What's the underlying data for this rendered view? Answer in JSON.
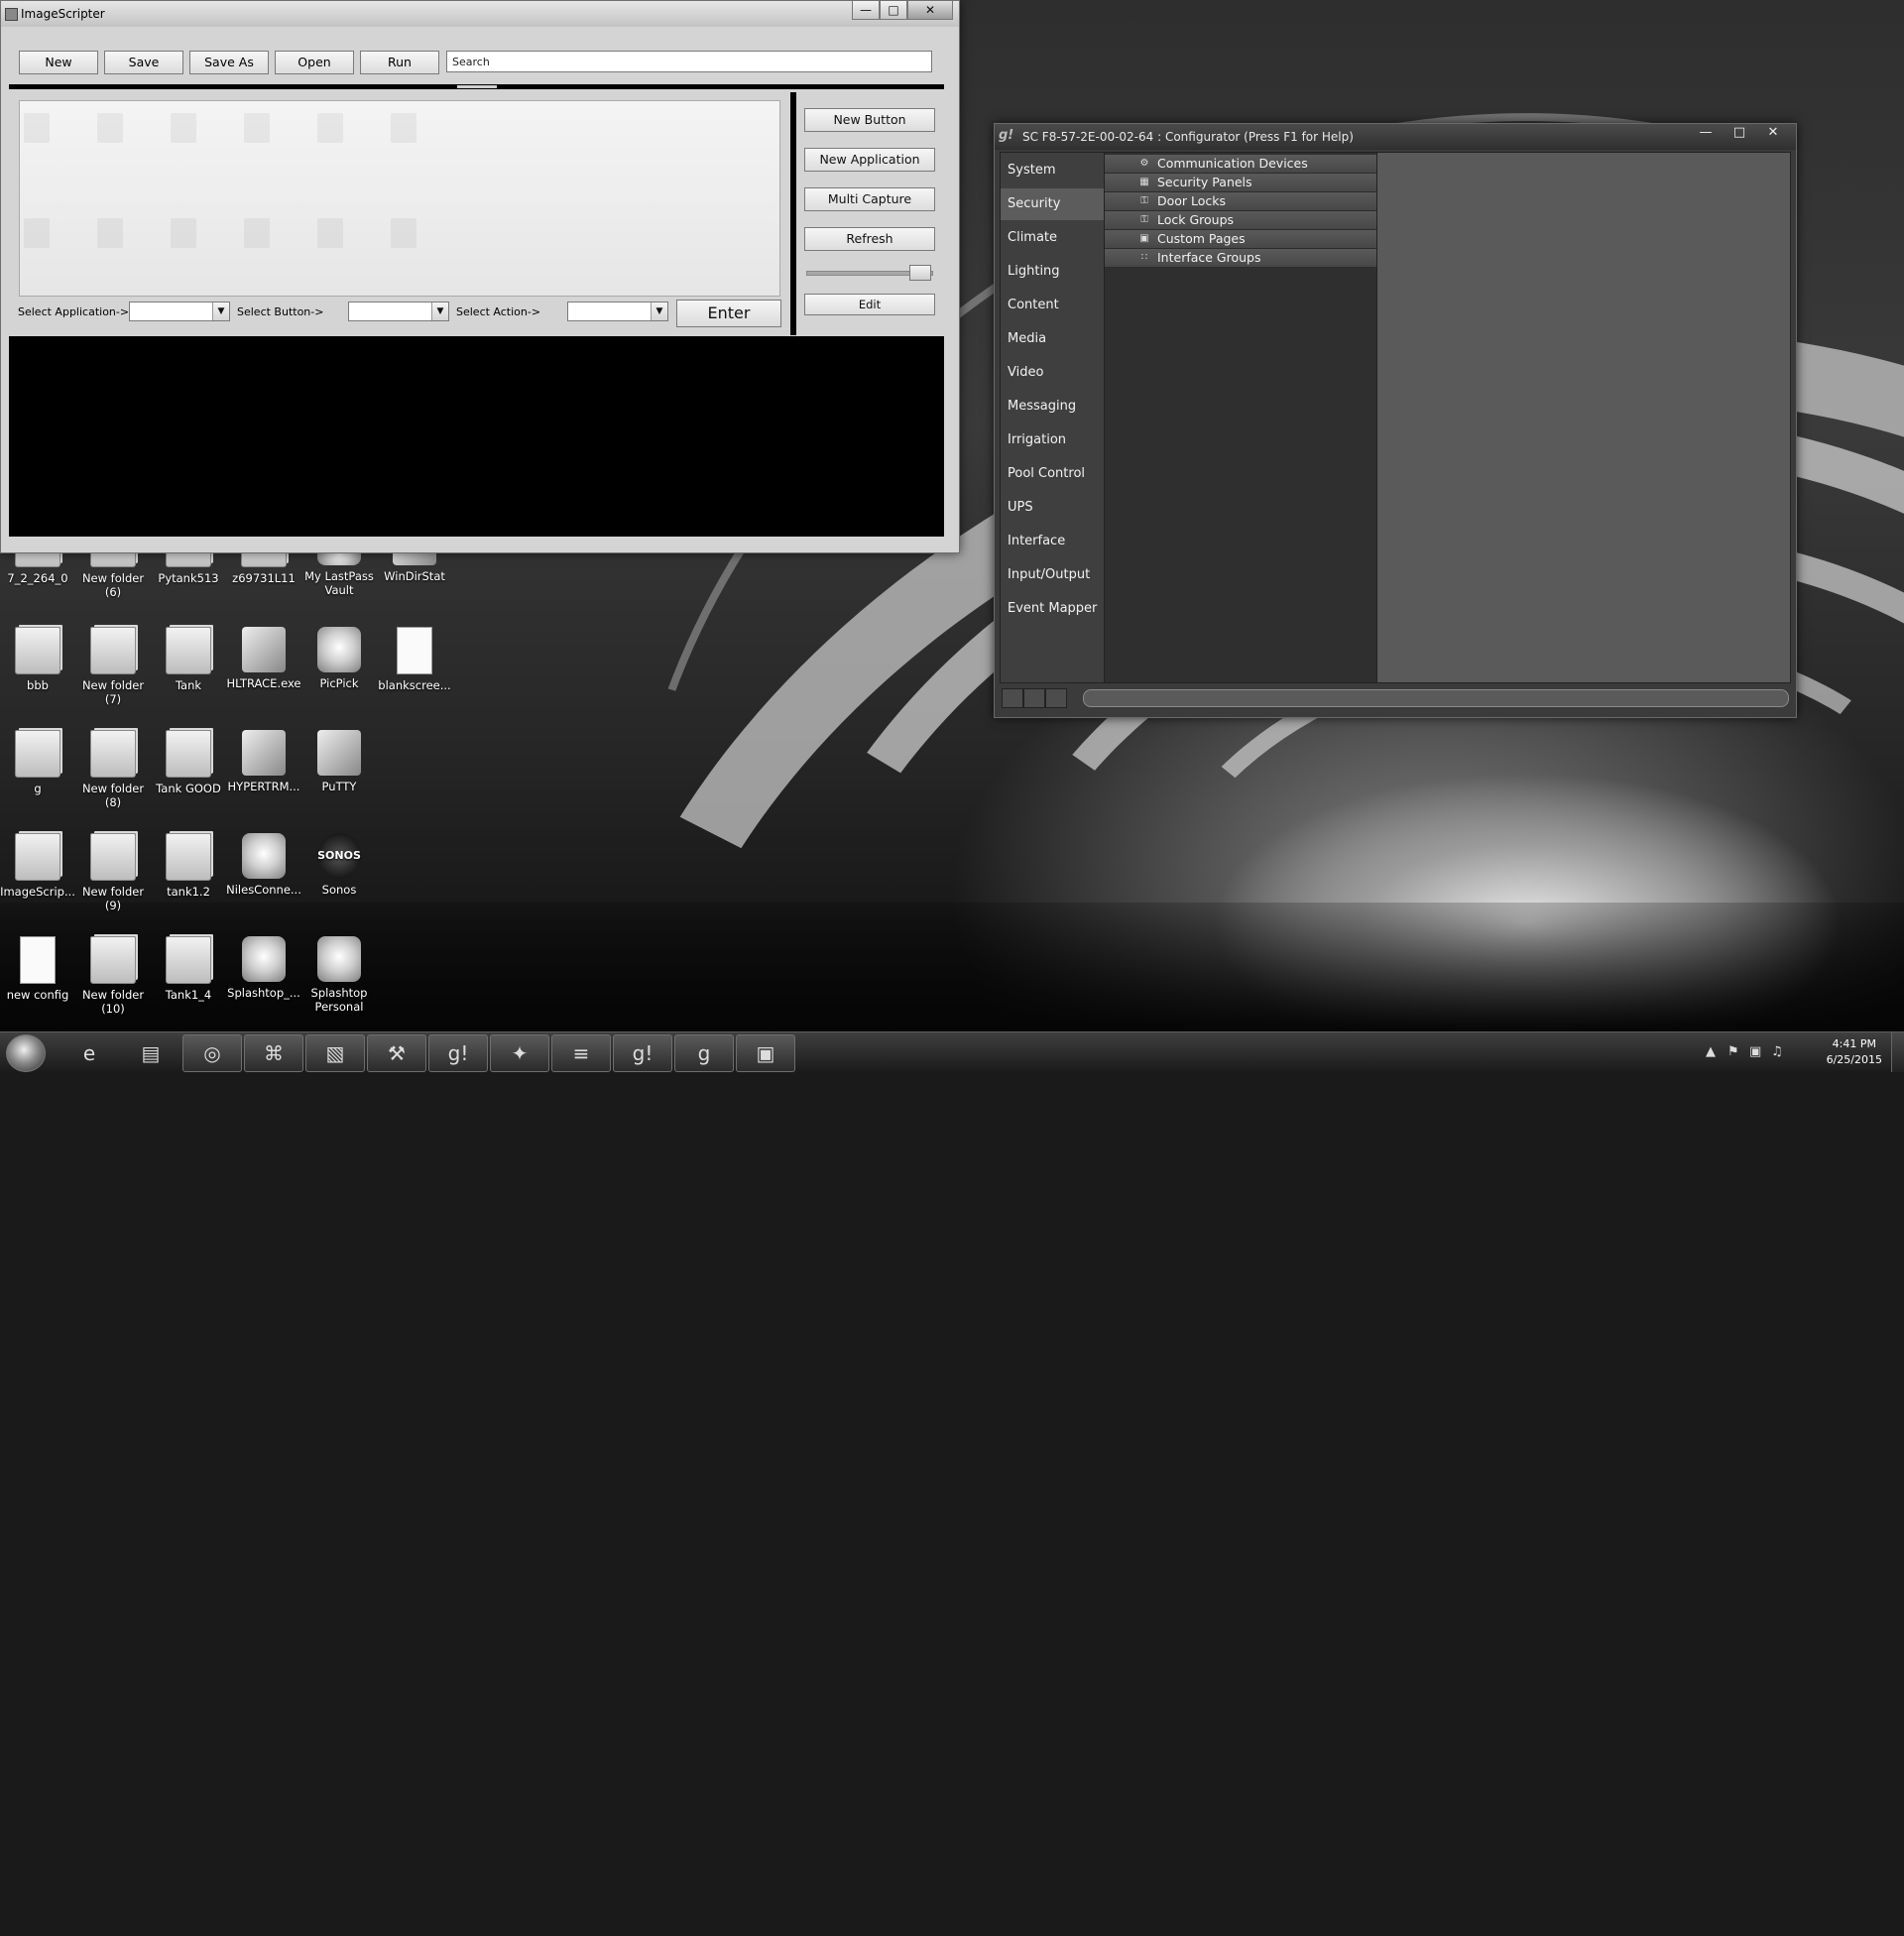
{
  "desktop": {
    "icon_rows": [
      [
        {
          "label": "7_2_264_0",
          "icon": "folder-icon"
        },
        {
          "label": "New folder (6)",
          "icon": "folder-icon"
        },
        {
          "label": "Pytank513",
          "icon": "folder-icon"
        },
        {
          "label": "z69731L11",
          "icon": "folder-icon"
        },
        {
          "label": "My LastPass Vault",
          "icon": "lastpass-icon"
        },
        {
          "label": "WinDirStat",
          "icon": "windirstat-icon"
        }
      ],
      [
        {
          "label": "bbb",
          "icon": "folder-icon"
        },
        {
          "label": "New folder (7)",
          "icon": "folder-icon"
        },
        {
          "label": "Tank",
          "icon": "folder-icon"
        },
        {
          "label": "HLTRACE.exe",
          "icon": "hltrace-icon"
        },
        {
          "label": "PicPick",
          "icon": "picpick-icon"
        },
        {
          "label": "blankscree...",
          "icon": "document-icon"
        }
      ],
      [
        {
          "label": "g",
          "icon": "folder-icon"
        },
        {
          "label": "New folder (8)",
          "icon": "folder-icon"
        },
        {
          "label": "Tank GOOD",
          "icon": "folder-icon"
        },
        {
          "label": "HYPERTRM...",
          "icon": "hyperterminal-icon"
        },
        {
          "label": "PuTTY",
          "icon": "putty-icon"
        }
      ],
      [
        {
          "label": "ImageScrip...",
          "icon": "folder-icon"
        },
        {
          "label": "New folder (9)",
          "icon": "folder-icon"
        },
        {
          "label": "tank1.2",
          "icon": "folder-icon"
        },
        {
          "label": "NilesConne...",
          "icon": "niles-icon"
        },
        {
          "label": "Sonos",
          "icon": "sonos-icon",
          "text": "SONOS"
        }
      ],
      [
        {
          "label": "new config",
          "icon": "config-icon"
        },
        {
          "label": "New folder (10)",
          "icon": "folder-icon"
        },
        {
          "label": "Tank1_4",
          "icon": "folder-icon"
        },
        {
          "label": "Splashtop_...",
          "icon": "splashtop-icon"
        },
        {
          "label": "Splashtop Personal",
          "icon": "splashtop-icon"
        }
      ]
    ]
  },
  "imagescripter": {
    "title": "ImageScripter",
    "toolbar": {
      "new_label": "New",
      "save_label": "Save",
      "save_as_label": "Save As",
      "open_label": "Open",
      "run_label": "Run",
      "search_value": "Search"
    },
    "right_buttons": {
      "new_button": "New Button",
      "new_application": "New Application",
      "multi_capture": "Multi Capture",
      "refresh": "Refresh",
      "edit": "Edit"
    },
    "selectors": {
      "application_label": "Select Application->",
      "button_label": "Select Button->",
      "action_label": "Select Action->",
      "enter_label": "Enter"
    }
  },
  "configurator": {
    "title": "SC F8-57-2E-00-02-64 : Configurator   (Press F1 for Help)",
    "nav": [
      "System",
      "Security",
      "Climate",
      "Lighting",
      "Content",
      "Media",
      "Video",
      "Messaging",
      "Irrigation",
      "Pool Control",
      "UPS",
      "Interface",
      "Input/Output",
      "Event Mapper"
    ],
    "active_nav": "Security",
    "tree": [
      {
        "label": "Communication Devices",
        "icon": "communication-devices-icon"
      },
      {
        "label": "Security Panels",
        "icon": "security-panel-icon"
      },
      {
        "label": "Door Locks",
        "icon": "lock-icon"
      },
      {
        "label": "Lock Groups",
        "icon": "lock-icon"
      },
      {
        "label": "Custom Pages",
        "icon": "page-icon"
      },
      {
        "label": "Interface Groups",
        "icon": "interface-groups-icon"
      }
    ]
  },
  "taskbar": {
    "time": "4:41 PM",
    "date": "6/25/2015",
    "apps": [
      "internet-explorer-icon",
      "file-explorer-icon",
      "chrome-icon",
      "remote-tool-icon",
      "notepad-icon",
      "tools-icon",
      "g-app-icon",
      "mouse-tool-icon",
      "console-icon",
      "g-app-icon",
      "configurator-icon",
      "imagescripter-icon"
    ]
  }
}
